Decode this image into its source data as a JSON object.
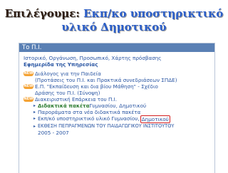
{
  "slide": {
    "title_part1": "Επιλέγουμε: ",
    "title_part2": "Εκπ/κο υποστηρικτικό",
    "title_line2": "υλικό Δημοτικού"
  },
  "panel": {
    "header": "Το Π.Ι.",
    "links": {
      "line1": "Ιστορικό, Οργάνωση, Προσωπικό, Χάρτης πρόσβασης",
      "newspaper": "Εφημερίδα της Υπηρεσίας"
    },
    "badge_label": "NEW",
    "items": [
      {
        "line1": "Διάλογος για την Παιδεία",
        "line2": "(Προτάσεις του Π.Ι. και Πρακτικά συνεδριάσεων ΣΠΔΕ)"
      },
      {
        "line1": "Ε.Π. \"Εκπαίδευση και δια βίου Μάθηση\" - Σχέδιο",
        "line2": "Δράσης του Π.Ι. (Σύνοψη)"
      },
      {
        "line1": "Διακειριστική Επάρκεια του Π.Ι.",
        "line2": ""
      }
    ],
    "subitems": [
      {
        "bold": "Διδακτικά πακέτα",
        "rest": " Γυμνασίου, Δημοτικού"
      },
      {
        "bold": "",
        "rest": "Παρoράματα στα νέα διδακτικά πακέτα"
      },
      {
        "bold": "",
        "rest": "Εκπ/κό υποστηρικτικό υλικό Γυμνασίου,",
        "highlight": "Δημοτικού"
      },
      {
        "bold": "",
        "rest": "ΕΚΘΕΣΗ ΠΕΠΡΑΓΜΕΝΩΝ ΤΟΥ ΠΑΙΔΑΓΩΓΙΚΟΥ ΙΝΣΤΙΤΟΥΤΟΥ",
        "line2": "2005 - 2007"
      }
    ]
  },
  "colors": {
    "title_accent": "#2c5fc9",
    "header_bg": "#5a80b4",
    "link": "#2a56a3",
    "badge": "#f4a233",
    "highlight_border": "#d42020"
  }
}
